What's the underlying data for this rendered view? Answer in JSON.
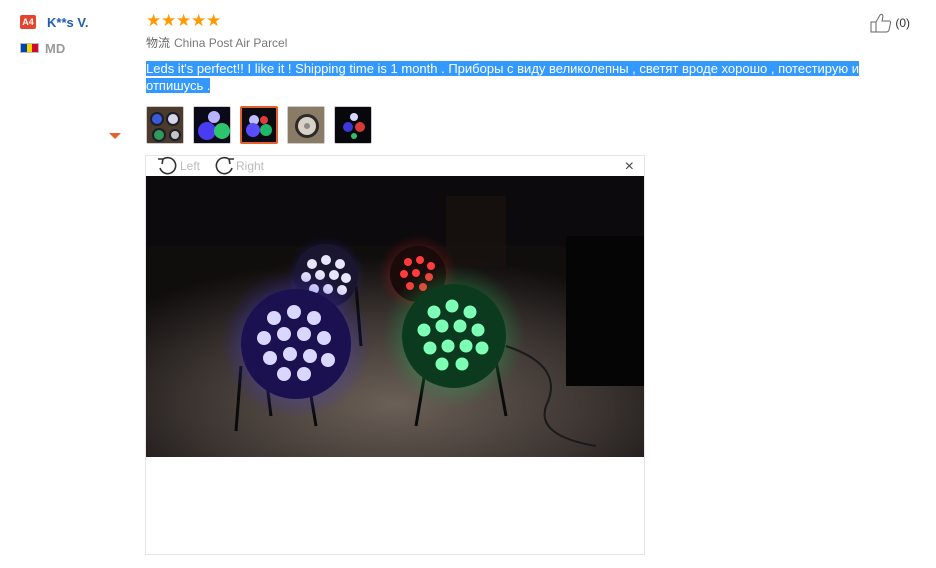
{
  "user": {
    "level": "A4",
    "name": "K**s V.",
    "country": "MD",
    "flag_colors": [
      "#0046ae",
      "#ffd200",
      "#cc092f"
    ]
  },
  "review": {
    "rating": 5,
    "stars": [
      "★",
      "★",
      "★",
      "★",
      "★"
    ],
    "shipping_label": "物流",
    "shipping_method": "China Post Air Parcel",
    "text": "Leds it's perfect!! I like it ! Shipping time is 1 month . Приборы с виду великолепны , светят вроде хорошо , потестирую и отпишусь .",
    "helpful_count": "(0)",
    "thumbnails": [
      "photo-1",
      "photo-2",
      "photo-3",
      "photo-4",
      "photo-5"
    ],
    "active_thumbnail": 3
  },
  "viewer": {
    "rotate_left": "Left",
    "rotate_right": "Right",
    "close": "×"
  },
  "colors": {
    "accent_orange": "#e4622c",
    "star": "#ff9a00",
    "name_blue": "#1e5db2",
    "selection_blue": "#3399ff"
  }
}
